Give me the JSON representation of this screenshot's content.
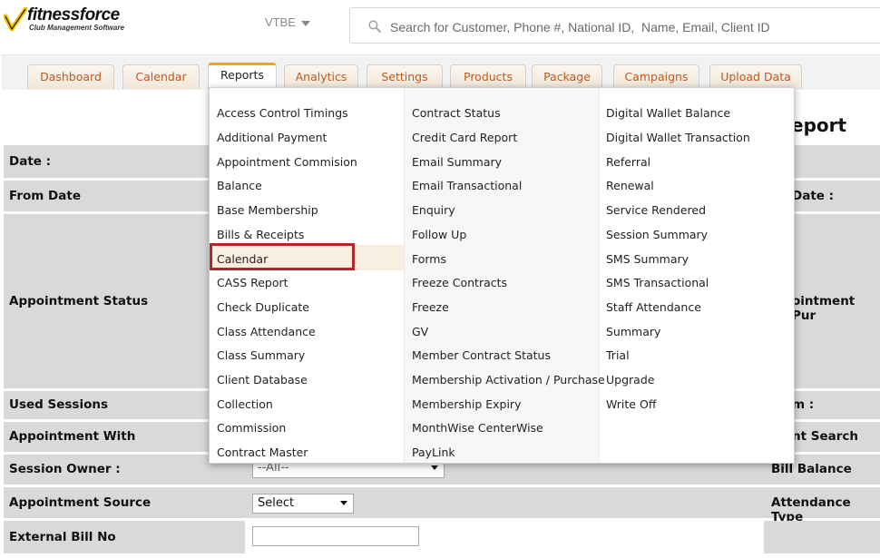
{
  "header": {
    "logo_text": "fitnessforce",
    "logo_subtitle": "Club Management Software",
    "branch": "VTBE",
    "search_placeholder": "Search for Customer, Phone #, National ID,  Name, Email, Client ID"
  },
  "tabs": [
    {
      "label": "Dashboard"
    },
    {
      "label": "Calendar"
    },
    {
      "label": "Reports",
      "active": true
    },
    {
      "label": "Analytics"
    },
    {
      "label": "Settings"
    },
    {
      "label": "Products"
    },
    {
      "label": "Package"
    },
    {
      "label": "Campaigns"
    },
    {
      "label": "Upload Data"
    }
  ],
  "form": {
    "title_partial": "eport",
    "labels": {
      "date": "Date :",
      "from_date": "From Date",
      "to_date_partial": "Date :",
      "appointment_status": "Appointment Status",
      "appointment_purpose_partial": "ointment Pur",
      "used_sessions": "Used Sessions",
      "from_partial": "m :",
      "appointment_with": "Appointment With",
      "client_search_partial": "nt Search",
      "session_owner": "Session Owner :",
      "bill_balance_partial": "Bill Balance",
      "appointment_source": "Appointment Source",
      "attendance_type_partial": "Attendance Type",
      "external_bill_no": "External Bill No"
    },
    "session_owner_value": "--All--",
    "appointment_source_value": "Select"
  },
  "reports_menu": {
    "highlighted": "Calendar",
    "col1": [
      "Access Control Timings",
      "Additional Payment",
      "Appointment Commision",
      "Balance",
      "Base Membership",
      "Bills & Receipts",
      "Calendar",
      "CASS Report",
      "Check Duplicate",
      "Class Attendance",
      "Class Summary",
      "Client Database",
      "Collection",
      "Commission",
      "Contract Master"
    ],
    "col2": [
      "Contract Status",
      "Credit Card Report",
      "Email Summary",
      "Email Transactional",
      "Enquiry",
      "Follow Up",
      "Forms",
      "Freeze Contracts",
      "Freeze",
      "GV",
      "Member Contract Status",
      "Membership Activation / Purchase",
      "Membership Expiry",
      "MonthWise CenterWise",
      "PayLink"
    ],
    "col3": [
      "Digital Wallet Balance",
      "Digital Wallet Transaction",
      "Referral",
      "Renewal",
      "Service Rendered",
      "Session Summary",
      "SMS Summary",
      "SMS Transactional",
      "Staff Attendance",
      "Summary",
      "Trial",
      "Upgrade",
      "Write Off"
    ]
  },
  "colors": {
    "tab_text": "#c0581f",
    "active_tab_accent": "#f0a030",
    "highlight_border": "#b3272b",
    "form_row_bg": "#d9d9d9"
  }
}
